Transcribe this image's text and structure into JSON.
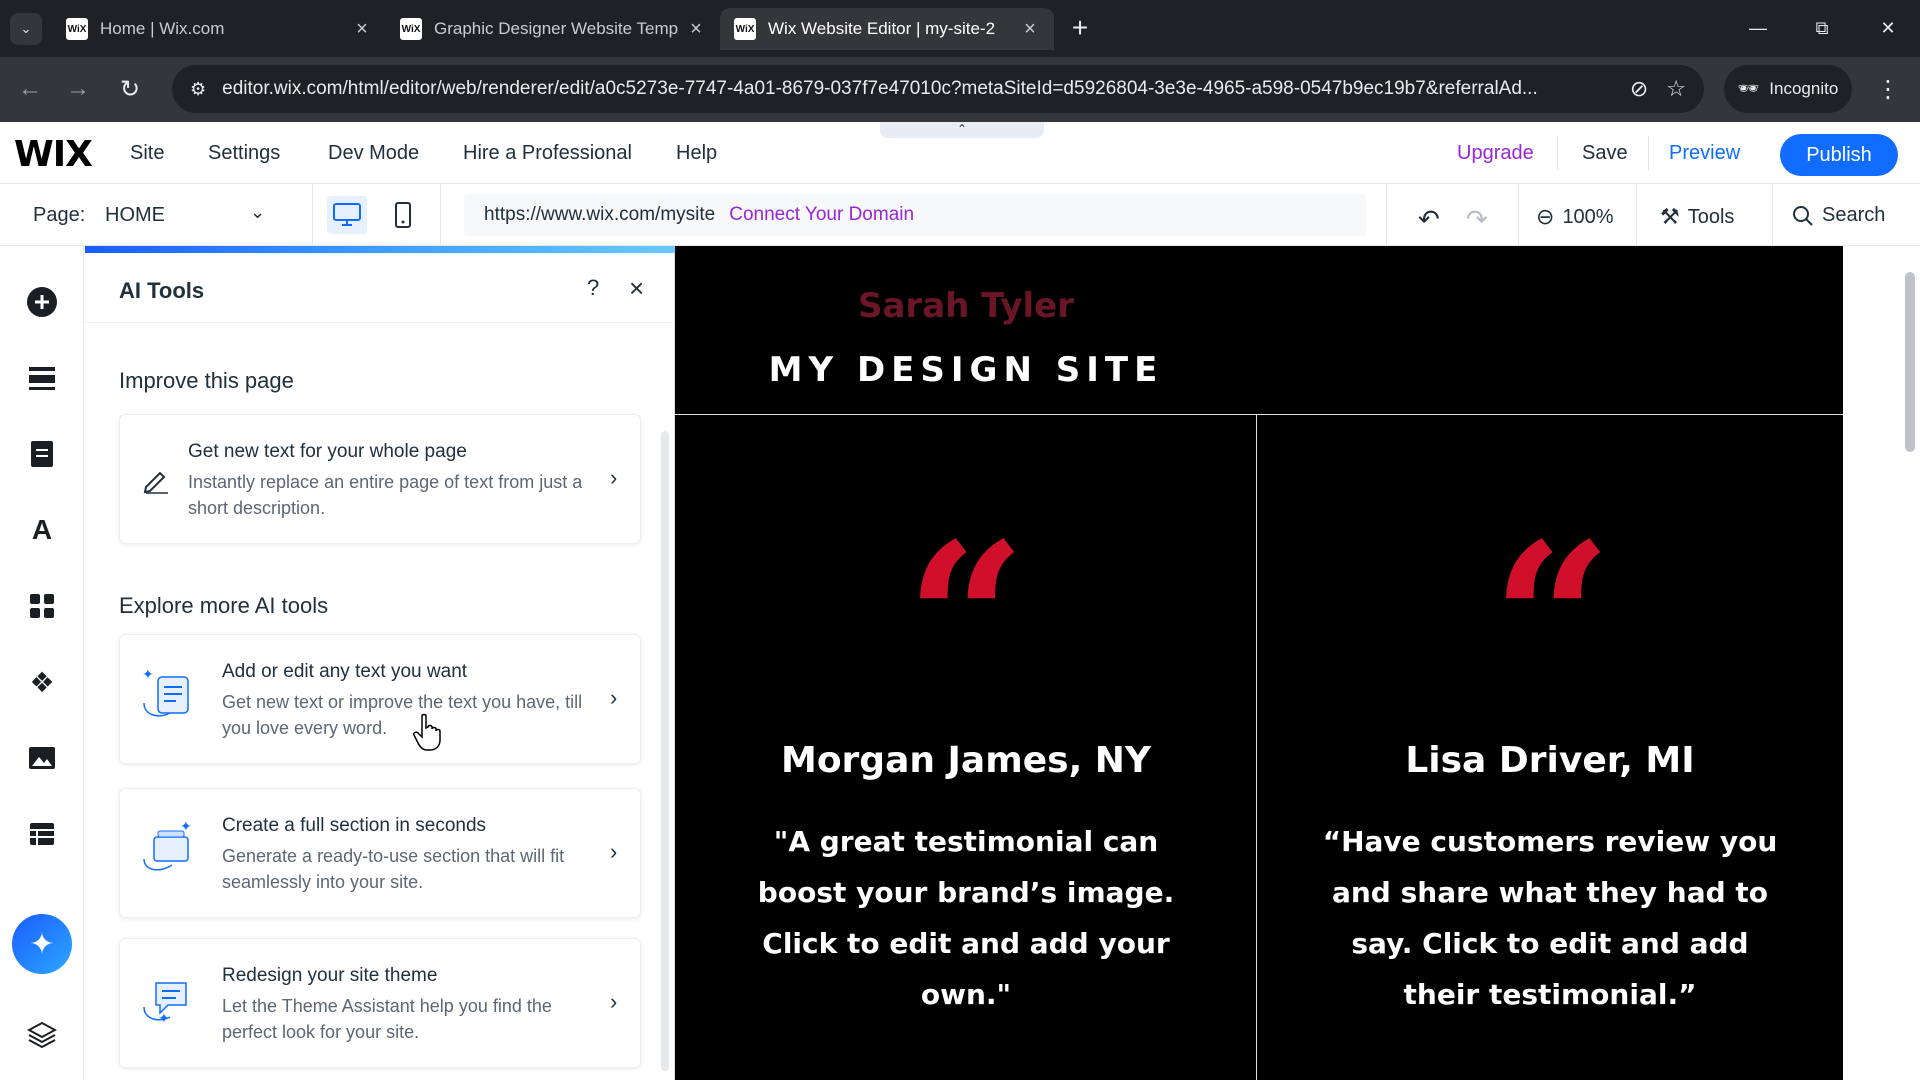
{
  "browser": {
    "tabs": [
      {
        "title": "Home | Wix.com",
        "favicon": "WiX",
        "active": false
      },
      {
        "title": "Graphic Designer Website Temp",
        "favicon": "WiX",
        "active": false
      },
      {
        "title": "Wix Website Editor | my-site-2",
        "favicon": "WiX",
        "active": true
      }
    ],
    "new_tab": "+",
    "url": "editor.wix.com/html/editor/web/renderer/edit/a0c5273e-7747-4a01-8679-037f7e47010c?metaSiteId=d5926804-3e3e-4965-a598-0547b9ec19b7&referralAd...",
    "incognito_label": "Incognito"
  },
  "wix": {
    "logo": "WIX",
    "menu": [
      "Site",
      "Settings",
      "Dev Mode",
      "Hire a Professional",
      "Help"
    ],
    "upgrade": "Upgrade",
    "save": "Save",
    "preview": "Preview",
    "publish": "Publish",
    "page_label": "Page:",
    "page_value": "HOME",
    "site_url": "https://www.wix.com/mysite",
    "connect_domain": "Connect Your Domain",
    "zoom": "100%",
    "tools": "Tools",
    "search": "Search"
  },
  "panel": {
    "title": "AI Tools",
    "help": "?",
    "section1": "Improve this page",
    "section2": "Explore more AI tools",
    "cards": [
      {
        "title": "Get new text for your whole page",
        "desc": "Instantly replace an entire page of text from just a short description."
      },
      {
        "title": "Add or edit any text you want",
        "desc": "Get new text or improve the text you have, till you love every word."
      },
      {
        "title": "Create a full section in seconds",
        "desc": "Generate a ready-to-use section that will fit seamlessly into your site."
      },
      {
        "title": "Redesign your site theme",
        "desc": "Let the Theme Assistant help you find the perfect look for your site."
      }
    ]
  },
  "site": {
    "brand": "Sarah Tyler",
    "title": "MY DESIGN SITE",
    "quote_mark": "“",
    "testimonials": [
      {
        "name": "Morgan James, NY",
        "text": "\"A great testimonial can boost your brand’s image. Click to edit and add your own.\""
      },
      {
        "name": "Lisa Driver, MI",
        "text": "“Have customers review you and share what they had to say. Click to edit and add their testimonial.”"
      }
    ]
  },
  "colors": {
    "publish_blue": "#116dff",
    "upgrade_purple": "#9a27d5",
    "quote_red": "#d0102a",
    "brand_maroon": "#6b1626"
  }
}
